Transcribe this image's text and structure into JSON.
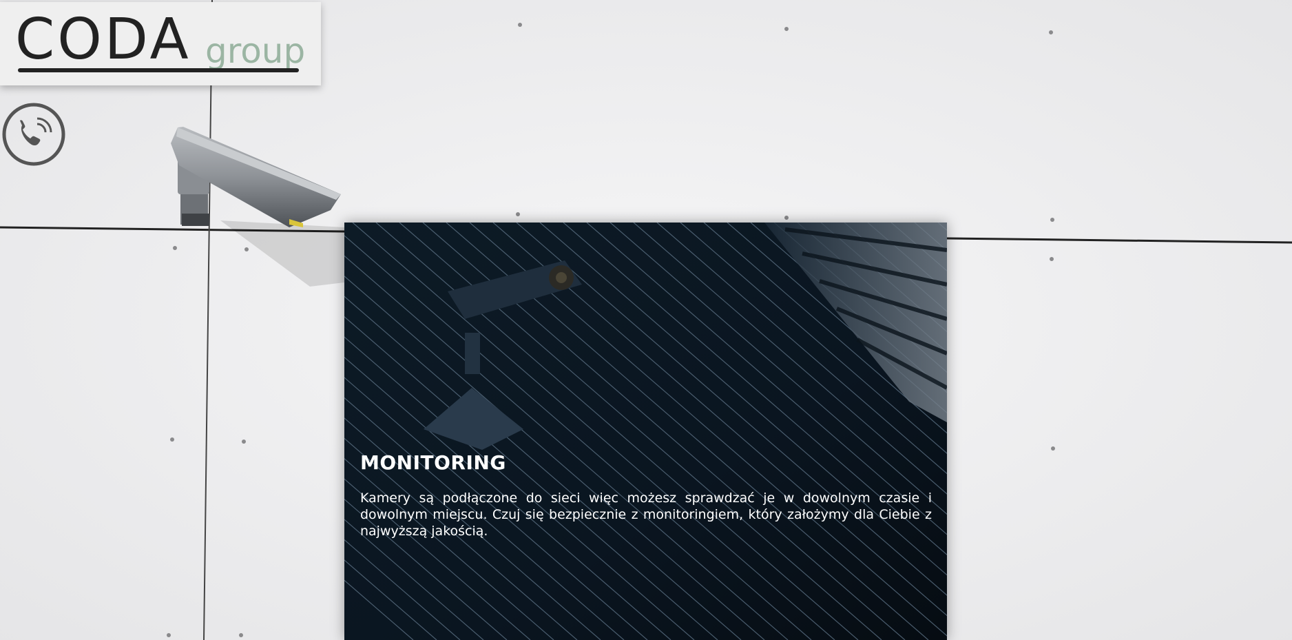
{
  "logo": {
    "main": "CODA",
    "sub": "group",
    "accent_color": "#9bb5a3"
  },
  "phone": {
    "icon": "phone-call-icon"
  },
  "card": {
    "title": "MONITORING",
    "text": "Kamery są podłączone do sieci więc możesz sprawdzać je w dowolnym czasie i dowolnym miejscu. Czuj się bezpiecznie z monitoringiem, który założymy dla Ciebie z najwyższą jakością."
  },
  "colors": {
    "card_bg": "#0b1620",
    "wall": "#efeff0",
    "text": "#ffffff"
  }
}
